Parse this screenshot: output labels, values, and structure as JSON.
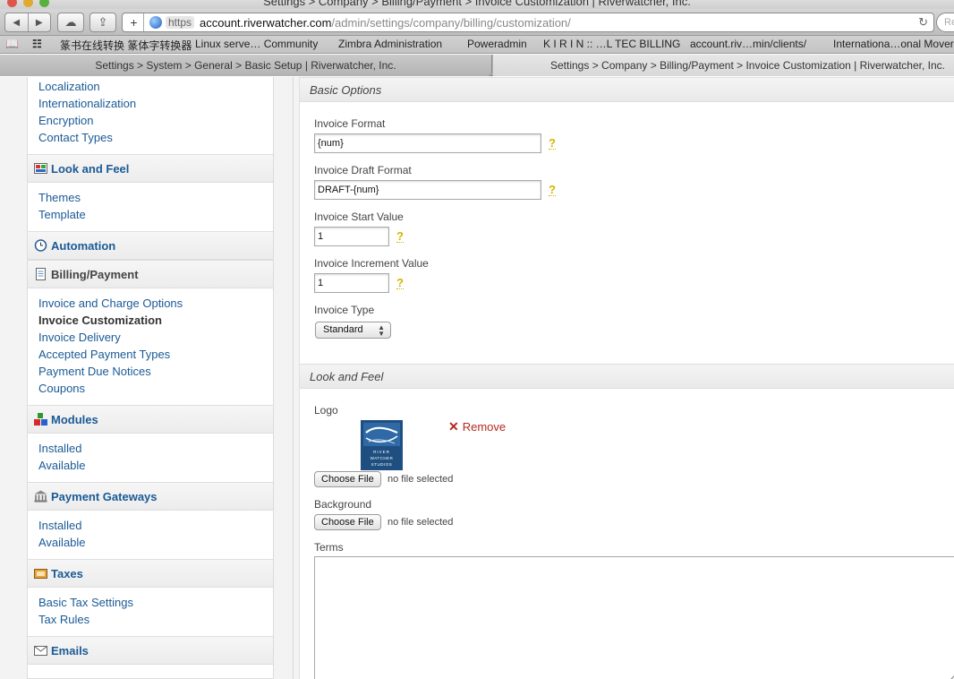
{
  "window": {
    "title": "Settings > Company > Billing/Payment > Invoice Customization | Riverwatcher, Inc."
  },
  "toolbar": {
    "back_icon": "back-arrow-icon",
    "forward_icon": "forward-arrow-icon",
    "url_https": "https",
    "url_host": "account.riverwatcher.com",
    "url_path": "/admin/settings/company/billing/customization/",
    "search_placeholder": "Re"
  },
  "bookmarks": [
    "篆书在线转换 篆体字转换器",
    "Linux serve… Community",
    "Zimbra Administration",
    "Poweradmin",
    "K I R I N :: …L TEC BILLING",
    "account.riv…min/clients/",
    "Internationa…onal Movers"
  ],
  "tabs": [
    {
      "label": "Settings > System > General > Basic Setup | Riverwatcher, Inc."
    },
    {
      "label": "Settings > Company > Billing/Payment > Invoice Customization | Riverwatcher, Inc."
    }
  ],
  "sidebar": {
    "top_links": [
      "Localization",
      "Internationalization",
      "Encryption",
      "Contact Types"
    ],
    "look_and_feel": {
      "title": "Look and Feel",
      "links": [
        "Themes",
        "Template"
      ]
    },
    "automation": {
      "title": "Automation"
    },
    "billing": {
      "title": "Billing/Payment",
      "links": [
        "Invoice and Charge Options",
        "Invoice Customization",
        "Invoice Delivery",
        "Accepted Payment Types",
        "Payment Due Notices",
        "Coupons"
      ],
      "current": "Invoice Customization"
    },
    "modules": {
      "title": "Modules",
      "links": [
        "Installed",
        "Available"
      ]
    },
    "gateways": {
      "title": "Payment Gateways",
      "links": [
        "Installed",
        "Available"
      ]
    },
    "taxes": {
      "title": "Taxes",
      "links": [
        "Basic Tax Settings",
        "Tax Rules"
      ]
    },
    "emails": {
      "title": "Emails"
    }
  },
  "main": {
    "basic_options": {
      "title": "Basic Options",
      "invoice_format": {
        "label": "Invoice Format",
        "value": "{num}"
      },
      "invoice_draft_format": {
        "label": "Invoice Draft Format",
        "value": "DRAFT-{num}"
      },
      "invoice_start_value": {
        "label": "Invoice Start Value",
        "value": "1"
      },
      "invoice_increment_value": {
        "label": "Invoice Increment Value",
        "value": "1"
      },
      "invoice_type": {
        "label": "Invoice Type",
        "value": "Standard"
      },
      "help_glyph": "?"
    },
    "look_and_feel": {
      "title": "Look and Feel",
      "logo_label": "Logo",
      "logo_text": "RIVER WATCHER STUDIOS",
      "remove_label": "Remove",
      "choose_file": "Choose File",
      "no_file": "no file selected",
      "background_label": "Background",
      "terms_label": "Terms"
    }
  }
}
